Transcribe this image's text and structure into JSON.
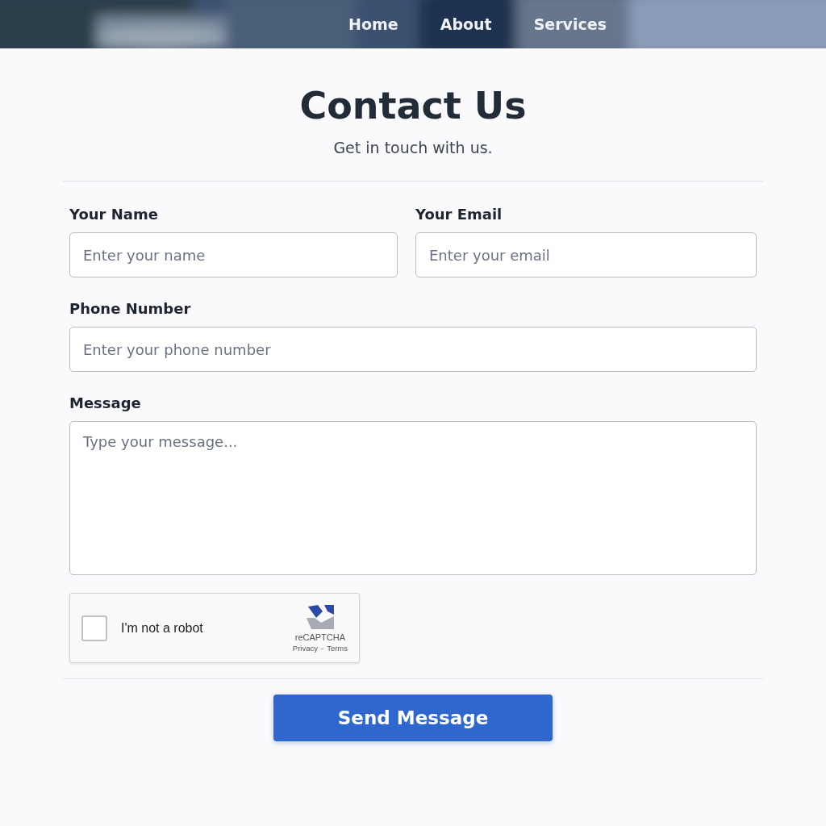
{
  "header": {
    "background": {
      "kind": "picture"
    },
    "nav": [
      "Home",
      "About",
      "Services"
    ]
  },
  "title": "Contact Us",
  "subtitle": "Get in touch with us.",
  "fields": [
    {
      "label": "Your Name",
      "placeholder": "Enter your name",
      "kind": "input"
    },
    {
      "label": "Your Email",
      "placeholder": "Enter your email",
      "kind": "input"
    },
    {
      "label": "Phone Number",
      "placeholder": "Enter your phone number",
      "kind": "input"
    },
    {
      "label": "Message",
      "placeholder": "Type your message...",
      "kind": "textarea"
    }
  ],
  "captcha": {
    "label": "I'm not a robot",
    "checked": false,
    "brand": "reCAPTCHA",
    "links": [
      "Privacy",
      "-",
      "Terms"
    ]
  },
  "submit": "Send Message"
}
